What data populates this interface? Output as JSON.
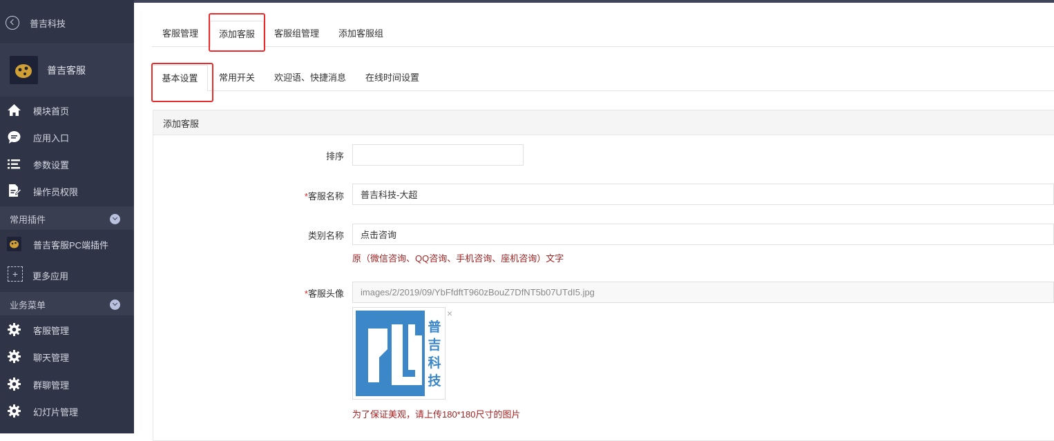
{
  "sidebar": {
    "back_title": "普吉科技",
    "profile_name": "普吉客服",
    "nav": [
      {
        "label": "模块首页",
        "icon": "home-icon"
      },
      {
        "label": "应用入口",
        "icon": "chat-bubble-icon"
      },
      {
        "label": "参数设置",
        "icon": "list-settings-icon"
      },
      {
        "label": "操作员权限",
        "icon": "document-edit-icon"
      }
    ],
    "section_plugins": "常用插件",
    "plugin_item": "普吉客服PC端插件",
    "more_apps": "更多应用",
    "section_business": "业务菜单",
    "business": [
      {
        "label": "客服管理",
        "icon": "gear-icon"
      },
      {
        "label": "聊天管理",
        "icon": "gear-icon"
      },
      {
        "label": "群聊管理",
        "icon": "gear-icon"
      },
      {
        "label": "幻灯片管理",
        "icon": "gear-icon"
      }
    ]
  },
  "tabs_top": [
    "客服管理",
    "添加客服",
    "客服组管理",
    "添加客服组"
  ],
  "tabs_sub": [
    "基本设置",
    "常用开关",
    "欢迎语、快捷消息",
    "在线时间设置"
  ],
  "panel": {
    "title": "添加客服",
    "sort_label": "排序",
    "sort_value": "",
    "name_label": "客服名称",
    "name_value": "普吉科技-大超",
    "category_label": "类别名称",
    "category_value": "点击咨询",
    "category_help": "原（微信咨询、QQ咨询、手机咨询、座机咨询）文字",
    "avatar_label": "客服头像",
    "avatar_path": "images/2/2019/09/YbFfdftT960zBouZ7DfNT5b07UTdI5.jpg",
    "avatar_remove": "×",
    "avatar_logo_chars": [
      "普",
      "吉",
      "科",
      "技"
    ],
    "avatar_help": "为了保证美观，请上传180*180尺寸的图片",
    "required_mark": "*"
  },
  "colors": {
    "sidebar_bg": "#2f3447",
    "highlight_red": "#ea2b2b",
    "help_text": "#a32222",
    "logo_blue": "#3b87c8"
  }
}
